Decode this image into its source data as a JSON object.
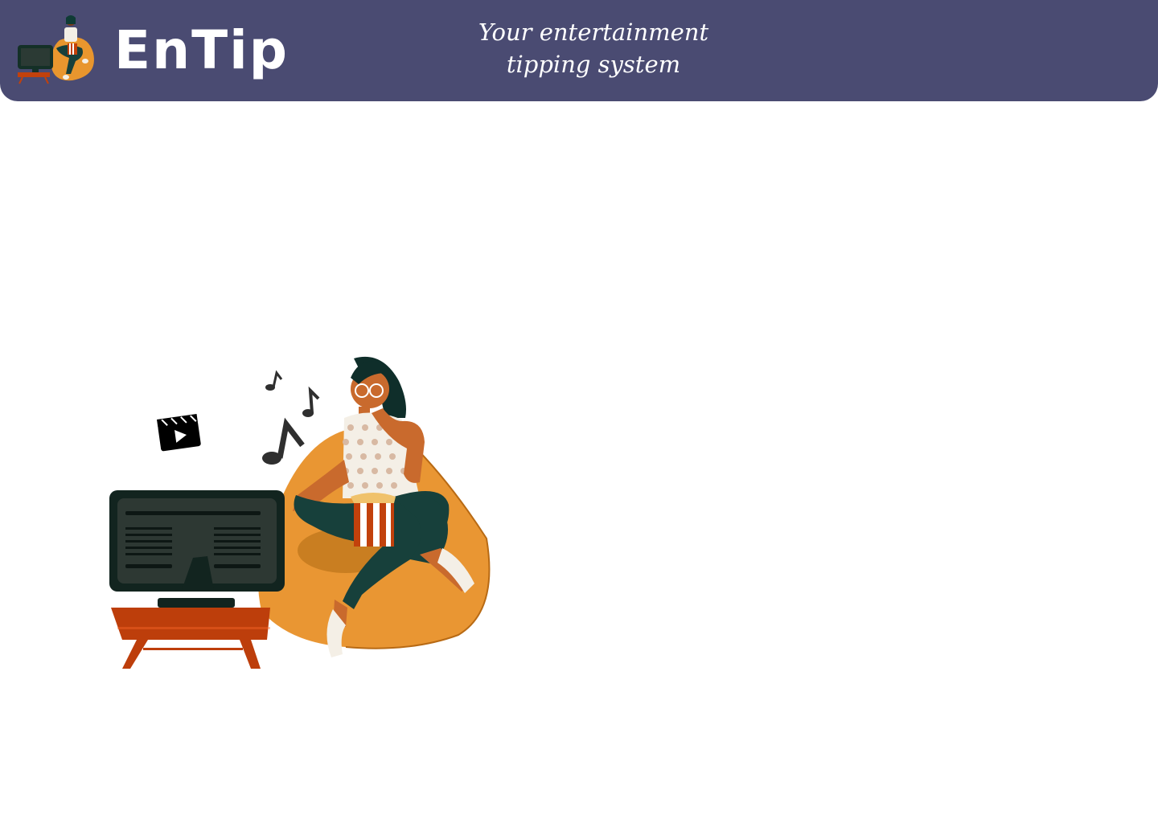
{
  "header": {
    "brand": "EnTip",
    "tagline_line1": "Your entertainment",
    "tagline_line2": "tipping system",
    "background_color": "#4a4b72"
  },
  "hero": {
    "illustration": "person-watching-tv-with-popcorn",
    "icons": [
      "film-clapper-icon",
      "music-note-icon"
    ]
  }
}
